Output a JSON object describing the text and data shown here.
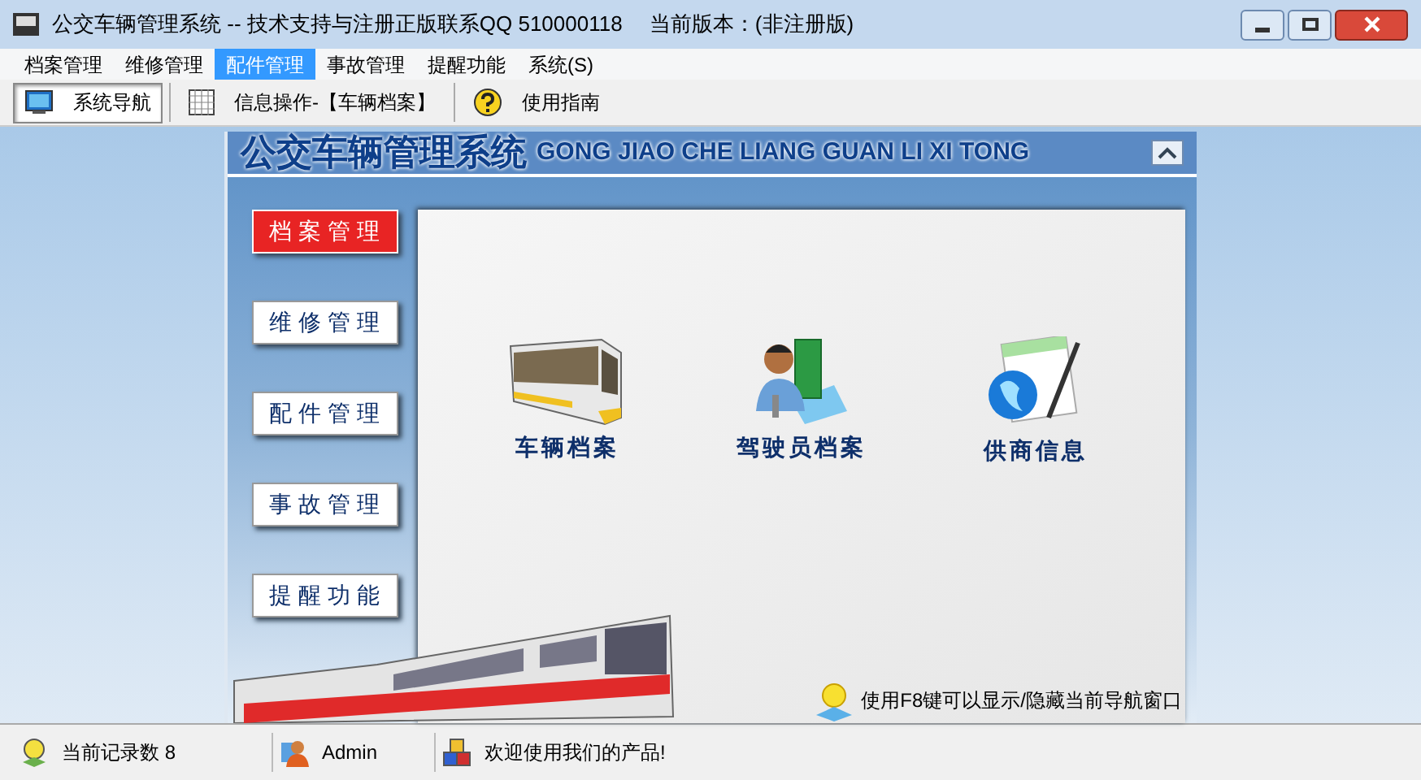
{
  "window": {
    "title": "公交车辆管理系统 -- 技术支持与注册正版联系QQ 510000118　 当前版本：(非注册版)"
  },
  "menu": [
    {
      "label": "档案管理",
      "selected": false
    },
    {
      "label": "维修管理",
      "selected": false
    },
    {
      "label": "配件管理",
      "selected": true
    },
    {
      "label": "事故管理",
      "selected": false
    },
    {
      "label": "提醒功能",
      "selected": false
    },
    {
      "label": "系统(S)",
      "selected": false
    }
  ],
  "toolbar": [
    {
      "label": "系统导航",
      "kind": "monitor",
      "selected": true
    },
    {
      "label": "信息操作-【车辆档案】",
      "kind": "grid",
      "selected": false
    },
    {
      "label": "使用指南",
      "kind": "help",
      "selected": false
    }
  ],
  "header": {
    "title": "公交车辆管理系统",
    "subtitle": "GONG JIAO CHE LIANG GUAN LI XI TONG"
  },
  "nav": [
    {
      "label": "档 案 管 理",
      "selected": true
    },
    {
      "label": "维 修 管 理",
      "selected": false
    },
    {
      "label": "配 件 管 理",
      "selected": false
    },
    {
      "label": "事 故 管 理",
      "selected": false
    },
    {
      "label": "提 醒 功 能",
      "selected": false
    }
  ],
  "modules": [
    {
      "label": "车辆档案",
      "kind": "bus"
    },
    {
      "label": "驾驶员档案",
      "kind": "driver"
    },
    {
      "label": "供商信息",
      "kind": "globe"
    }
  ],
  "hint": "使用F8键可以显示/隐藏当前导航窗口",
  "status_bar": [
    {
      "text": "当前记录数 8",
      "kind": "records"
    },
    {
      "text": "Admin",
      "kind": "user"
    },
    {
      "text": "欢迎使用我们的产品!",
      "kind": "product"
    }
  ]
}
